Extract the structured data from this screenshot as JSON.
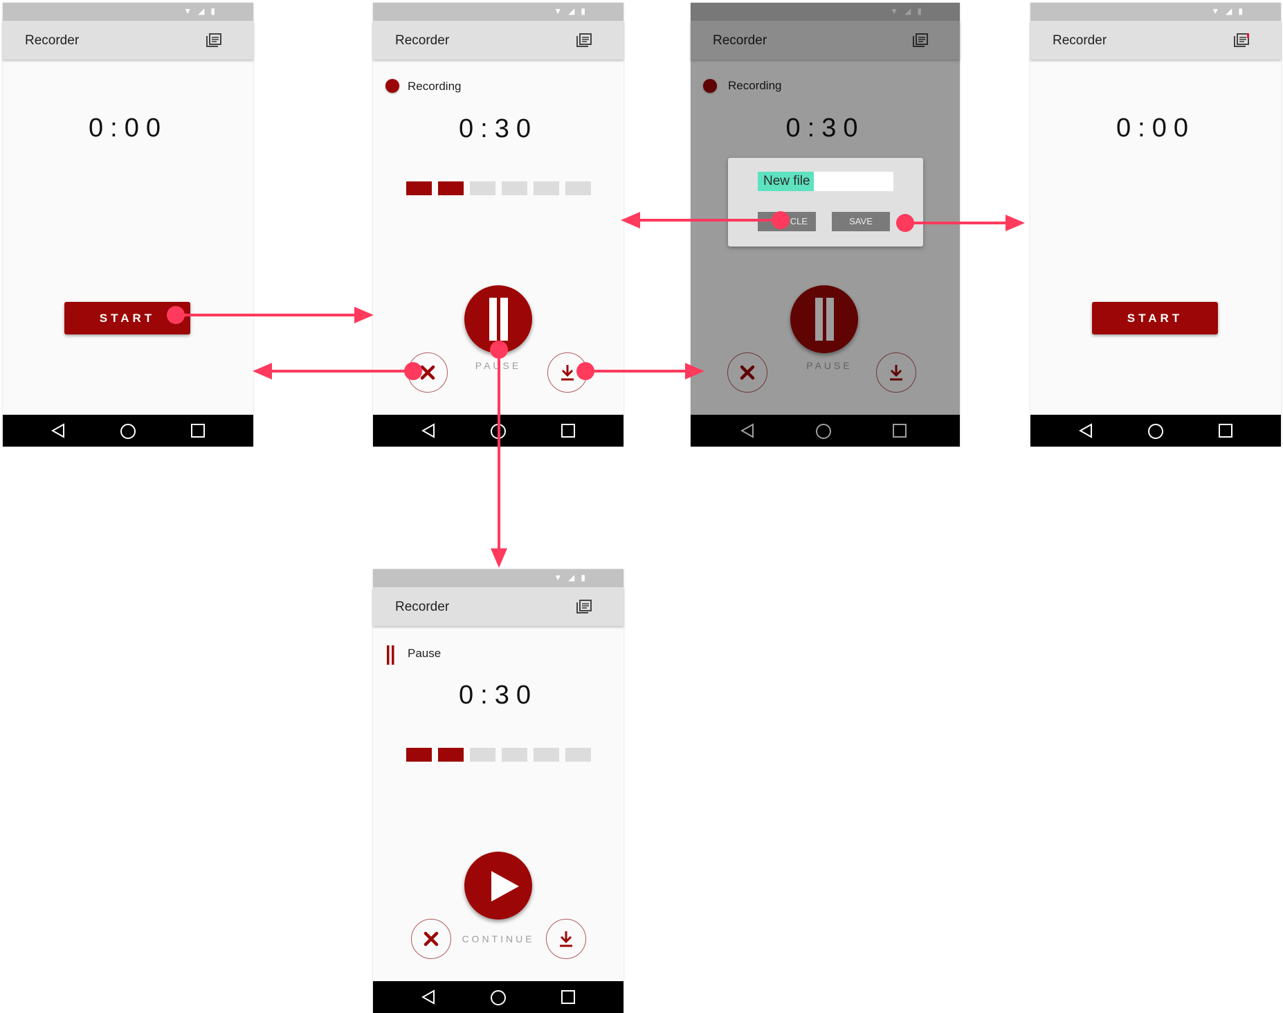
{
  "colors": {
    "accent": "#9c0606",
    "arrow": "#ff3a5c",
    "progress_empty": "#dcdcdc",
    "input_highlight": "#5ee2c0"
  },
  "icons": {
    "status": "wifi-signal-battery-icons",
    "appbar": "library-list-icon",
    "nav": [
      "back-triangle-icon",
      "home-circle-icon",
      "recents-square-icon"
    ],
    "actions": [
      "close-x-icon",
      "download-icon",
      "pause-icon",
      "play-icon"
    ]
  },
  "app": {
    "title": "Recorder"
  },
  "screens": {
    "idle": {
      "timer": "0:00",
      "start_label": "START"
    },
    "recording": {
      "status": "Recording",
      "timer": "0:30",
      "progress": {
        "filled": 2,
        "total": 6
      },
      "main_caption": "PAUSE"
    },
    "save_dialog": {
      "status": "Recording",
      "timer": "0:30",
      "main_caption": "PAUSE",
      "filename": "New file",
      "cancel_label": "CANCLE",
      "cancel_visible": "CLE",
      "save_label": "SAVE"
    },
    "saved": {
      "timer": "0:00",
      "start_label": "START"
    },
    "paused": {
      "status": "Pause",
      "timer": "0:30",
      "progress": {
        "filled": 2,
        "total": 6
      },
      "main_caption": "CONTINUE"
    }
  },
  "flows": [
    {
      "from": "idle.start_button",
      "to": "recording"
    },
    {
      "from": "recording.cancel_button",
      "to": "idle"
    },
    {
      "from": "recording.pause_button",
      "to": "paused"
    },
    {
      "from": "recording.save_button",
      "to": "save_dialog"
    },
    {
      "from": "save_dialog.cancel_button",
      "to": "recording"
    },
    {
      "from": "save_dialog.save_button",
      "to": "saved"
    }
  ]
}
